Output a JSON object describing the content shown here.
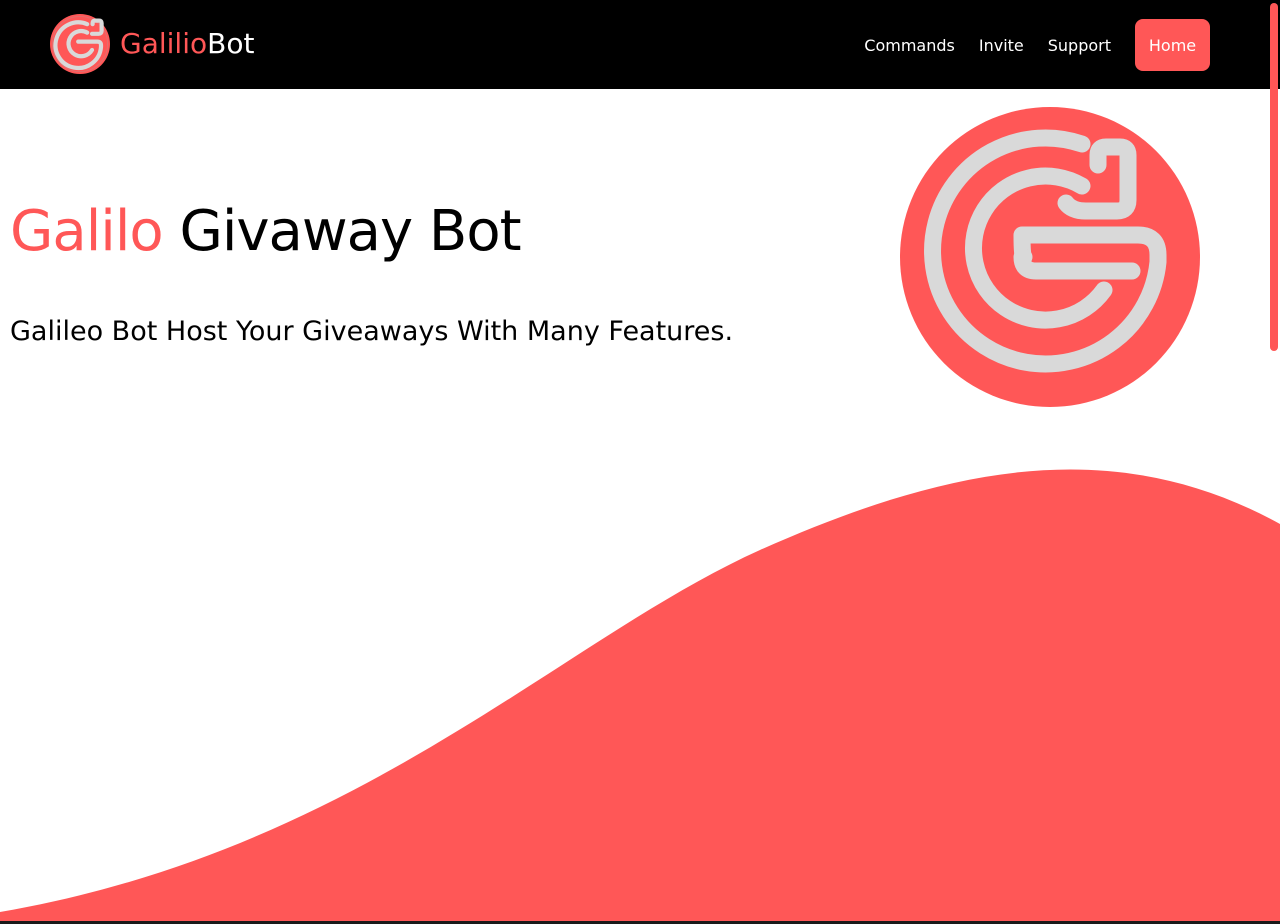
{
  "navbar": {
    "brand_accent": "Galilio",
    "brand_rest": "Bot",
    "links": [
      {
        "label": "Commands"
      },
      {
        "label": "Invite"
      },
      {
        "label": "Support"
      }
    ],
    "home_label": "Home"
  },
  "hero": {
    "title_accent": "Galilo",
    "title_rest": " Givaway Bot",
    "subtitle": "Galileo Bot Host Your Giveaways With Many Features."
  },
  "icons": {
    "brand_logo": "galileo-g-logo-icon",
    "hero_logo": "galileo-g-logo-icon"
  },
  "colors": {
    "accent": "#ff5757",
    "navbar_bg": "#000000",
    "logo_stroke": "#d9d9d9",
    "text": "#000000"
  }
}
